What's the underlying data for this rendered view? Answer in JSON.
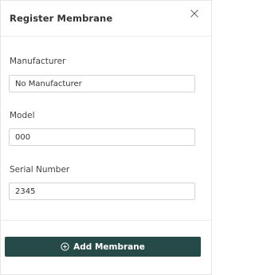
{
  "modal": {
    "title": "Register Membrane",
    "close_icon": "close-icon"
  },
  "fields": {
    "manufacturer": {
      "label": "Manufacturer",
      "value": "No Manufacturer"
    },
    "model": {
      "label": "Model",
      "value": "000"
    },
    "serial_number": {
      "label": "Serial Number",
      "value": "2345"
    }
  },
  "actions": {
    "add_label": "Add Membrane",
    "add_icon": "plus-circle-icon"
  },
  "colors": {
    "primary": "#264a47",
    "border": "#d4d4d4"
  }
}
